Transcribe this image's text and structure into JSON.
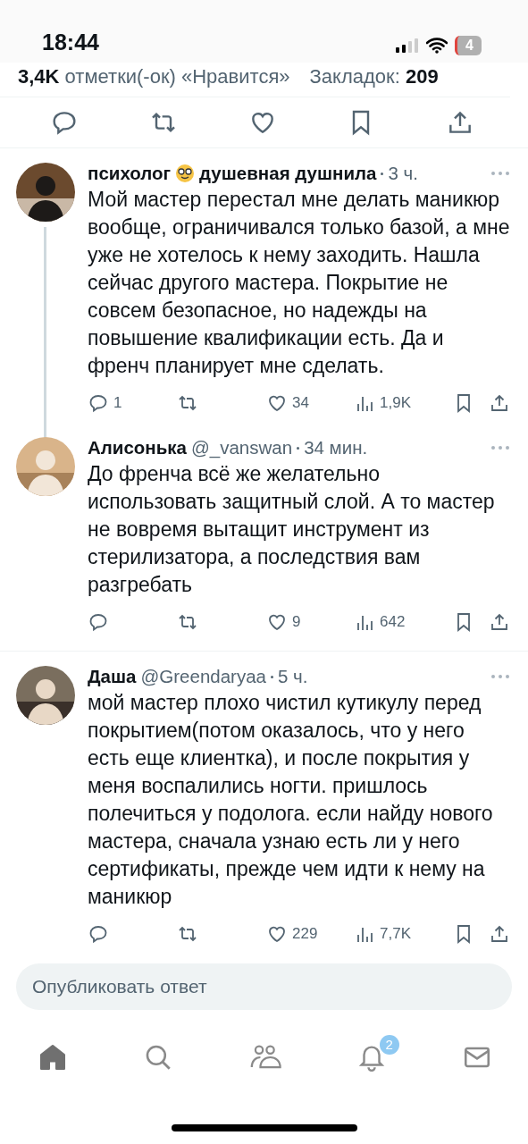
{
  "status_bar": {
    "time": "18:44",
    "battery": "4"
  },
  "post_stats": {
    "likes_count": "3,4K",
    "likes_label": "отметки(-ок) «Нравится»",
    "bookmarks_label": "Закладок:",
    "bookmarks_count": "209"
  },
  "replies": [
    {
      "name": "психолог",
      "emoji": true,
      "name_suffix": "душевная душнила",
      "time": "3 ч.",
      "thread": true,
      "text": "Мой мастер перестал мне делать маникюр вообще, ограничивался только базой, а мне уже не хотелось к нему заходить. Нашла сейчас другого мастера. Покрытие не совсем безопасное, но надежды на повышение квалификации есть. Да и френч планирует мне сделать.",
      "replies": "1",
      "likes": "34",
      "views": "1,9K"
    },
    {
      "name": "Алисонька",
      "emoji": false,
      "handle": "@_vanswan",
      "time": "34 мин.",
      "thread": false,
      "text": "До френча всё же желательно использовать защитный слой. А то мастер не вовремя вытащит инструмент из стерилизатора, а последствия вам разгребать",
      "likes": "9",
      "views": "642"
    },
    {
      "name": "Даша",
      "emoji": false,
      "handle": "@Greendaryaa",
      "time": "5 ч.",
      "thread": false,
      "text": "мой мастер плохо чистил кутикулу перед покрытием(потом оказалось, что у него есть еще клиентка), и после покрытия у меня воспалились ногти. пришлось полечиться у подолога. если найду нового мастера, сначала узнаю есть ли у него сертификаты, прежде чем идти к нему на маникюр",
      "likes": "229",
      "views": "7,7K"
    }
  ],
  "composer": {
    "placeholder": "Опубликовать ответ"
  },
  "nav": [
    {
      "kind": "home",
      "selected": true
    },
    {
      "kind": "search",
      "selected": false
    },
    {
      "kind": "communities",
      "selected": false
    },
    {
      "kind": "notifications",
      "selected": false,
      "badge": "2"
    },
    {
      "kind": "messages",
      "selected": false
    }
  ]
}
